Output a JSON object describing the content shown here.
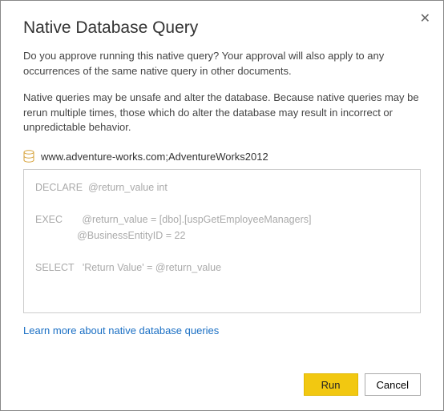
{
  "dialog": {
    "title": "Native Database Query",
    "description1": "Do you approve running this native query? Your approval will also apply to any occurrences of the same native query in other documents.",
    "description2": "Native queries may be unsafe and alter the database. Because native queries may be rerun multiple times, those which do alter the database may result in incorrect or unpredictable behavior.",
    "source": "www.adventure-works.com;AdventureWorks2012",
    "query": "DECLARE  @return_value int\n\nEXEC       @return_value = [dbo].[uspGetEmployeeManagers]\n               @BusinessEntityID = 22\n\nSELECT   'Return Value' = @return_value",
    "learn_more": "Learn more about native database queries",
    "run_label": "Run",
    "cancel_label": "Cancel",
    "close_label": "✕"
  }
}
